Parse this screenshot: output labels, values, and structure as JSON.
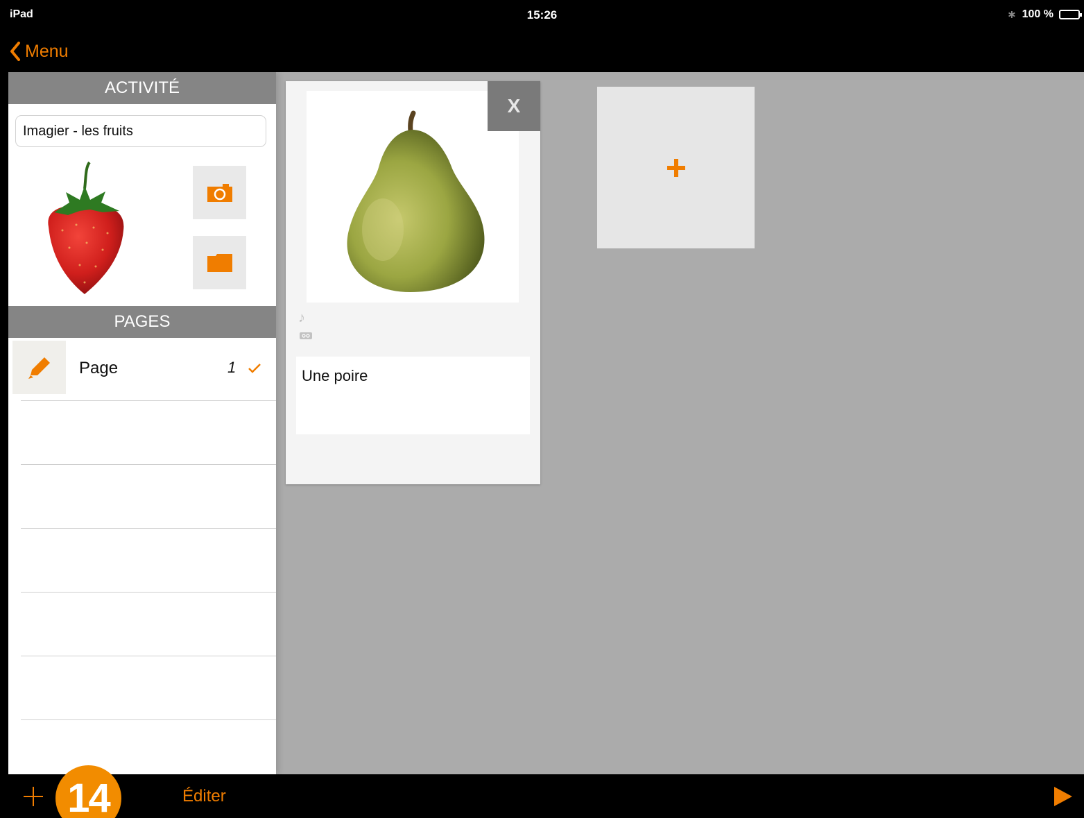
{
  "status_bar": {
    "carrier": "iPad",
    "time": "15:26",
    "battery": "100 %",
    "battery_level": 1.0
  },
  "nav": {
    "back_label": "Menu"
  },
  "sidebar": {
    "activity_header": "ACTIVITÉ",
    "activity_name": "Imagier - les fruits",
    "activity_image": "strawberry",
    "pages_header": "PAGES",
    "pages": [
      {
        "label": "Page",
        "number": "1",
        "checked": true
      }
    ]
  },
  "card": {
    "image": "pear",
    "close_label": "X",
    "text": "Une poire"
  },
  "toolbar": {
    "badge": "14",
    "edit_label": "Éditer"
  },
  "colors": {
    "accent": "#f07d00",
    "header_gray": "#858585",
    "canvas": "#ababab",
    "badge": "#f28c00"
  }
}
